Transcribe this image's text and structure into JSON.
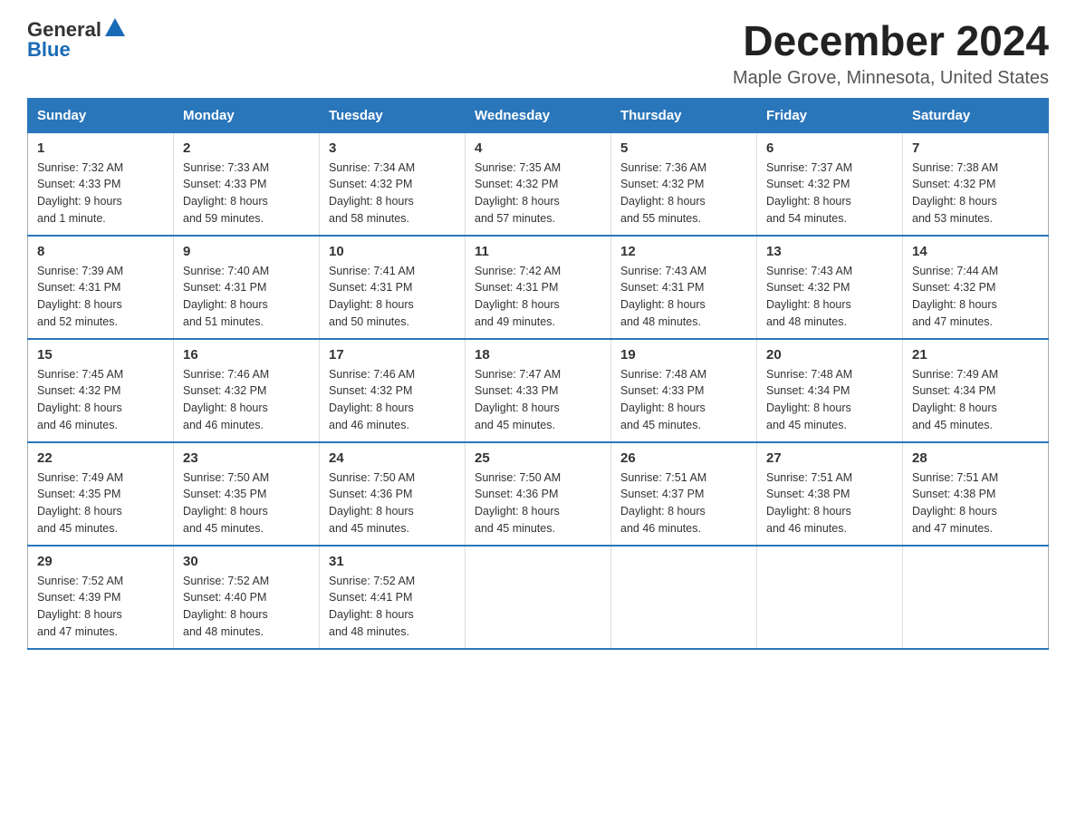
{
  "header": {
    "logo_general": "General",
    "logo_blue": "Blue",
    "month_title": "December 2024",
    "location": "Maple Grove, Minnesota, United States"
  },
  "days_of_week": [
    "Sunday",
    "Monday",
    "Tuesday",
    "Wednesday",
    "Thursday",
    "Friday",
    "Saturday"
  ],
  "weeks": [
    [
      {
        "day": "1",
        "sunrise": "7:32 AM",
        "sunset": "4:33 PM",
        "daylight": "9 hours and 1 minute."
      },
      {
        "day": "2",
        "sunrise": "7:33 AM",
        "sunset": "4:33 PM",
        "daylight": "8 hours and 59 minutes."
      },
      {
        "day": "3",
        "sunrise": "7:34 AM",
        "sunset": "4:32 PM",
        "daylight": "8 hours and 58 minutes."
      },
      {
        "day": "4",
        "sunrise": "7:35 AM",
        "sunset": "4:32 PM",
        "daylight": "8 hours and 57 minutes."
      },
      {
        "day": "5",
        "sunrise": "7:36 AM",
        "sunset": "4:32 PM",
        "daylight": "8 hours and 55 minutes."
      },
      {
        "day": "6",
        "sunrise": "7:37 AM",
        "sunset": "4:32 PM",
        "daylight": "8 hours and 54 minutes."
      },
      {
        "day": "7",
        "sunrise": "7:38 AM",
        "sunset": "4:32 PM",
        "daylight": "8 hours and 53 minutes."
      }
    ],
    [
      {
        "day": "8",
        "sunrise": "7:39 AM",
        "sunset": "4:31 PM",
        "daylight": "8 hours and 52 minutes."
      },
      {
        "day": "9",
        "sunrise": "7:40 AM",
        "sunset": "4:31 PM",
        "daylight": "8 hours and 51 minutes."
      },
      {
        "day": "10",
        "sunrise": "7:41 AM",
        "sunset": "4:31 PM",
        "daylight": "8 hours and 50 minutes."
      },
      {
        "day": "11",
        "sunrise": "7:42 AM",
        "sunset": "4:31 PM",
        "daylight": "8 hours and 49 minutes."
      },
      {
        "day": "12",
        "sunrise": "7:43 AM",
        "sunset": "4:31 PM",
        "daylight": "8 hours and 48 minutes."
      },
      {
        "day": "13",
        "sunrise": "7:43 AM",
        "sunset": "4:32 PM",
        "daylight": "8 hours and 48 minutes."
      },
      {
        "day": "14",
        "sunrise": "7:44 AM",
        "sunset": "4:32 PM",
        "daylight": "8 hours and 47 minutes."
      }
    ],
    [
      {
        "day": "15",
        "sunrise": "7:45 AM",
        "sunset": "4:32 PM",
        "daylight": "8 hours and 46 minutes."
      },
      {
        "day": "16",
        "sunrise": "7:46 AM",
        "sunset": "4:32 PM",
        "daylight": "8 hours and 46 minutes."
      },
      {
        "day": "17",
        "sunrise": "7:46 AM",
        "sunset": "4:32 PM",
        "daylight": "8 hours and 46 minutes."
      },
      {
        "day": "18",
        "sunrise": "7:47 AM",
        "sunset": "4:33 PM",
        "daylight": "8 hours and 45 minutes."
      },
      {
        "day": "19",
        "sunrise": "7:48 AM",
        "sunset": "4:33 PM",
        "daylight": "8 hours and 45 minutes."
      },
      {
        "day": "20",
        "sunrise": "7:48 AM",
        "sunset": "4:34 PM",
        "daylight": "8 hours and 45 minutes."
      },
      {
        "day": "21",
        "sunrise": "7:49 AM",
        "sunset": "4:34 PM",
        "daylight": "8 hours and 45 minutes."
      }
    ],
    [
      {
        "day": "22",
        "sunrise": "7:49 AM",
        "sunset": "4:35 PM",
        "daylight": "8 hours and 45 minutes."
      },
      {
        "day": "23",
        "sunrise": "7:50 AM",
        "sunset": "4:35 PM",
        "daylight": "8 hours and 45 minutes."
      },
      {
        "day": "24",
        "sunrise": "7:50 AM",
        "sunset": "4:36 PM",
        "daylight": "8 hours and 45 minutes."
      },
      {
        "day": "25",
        "sunrise": "7:50 AM",
        "sunset": "4:36 PM",
        "daylight": "8 hours and 45 minutes."
      },
      {
        "day": "26",
        "sunrise": "7:51 AM",
        "sunset": "4:37 PM",
        "daylight": "8 hours and 46 minutes."
      },
      {
        "day": "27",
        "sunrise": "7:51 AM",
        "sunset": "4:38 PM",
        "daylight": "8 hours and 46 minutes."
      },
      {
        "day": "28",
        "sunrise": "7:51 AM",
        "sunset": "4:38 PM",
        "daylight": "8 hours and 47 minutes."
      }
    ],
    [
      {
        "day": "29",
        "sunrise": "7:52 AM",
        "sunset": "4:39 PM",
        "daylight": "8 hours and 47 minutes."
      },
      {
        "day": "30",
        "sunrise": "7:52 AM",
        "sunset": "4:40 PM",
        "daylight": "8 hours and 48 minutes."
      },
      {
        "day": "31",
        "sunrise": "7:52 AM",
        "sunset": "4:41 PM",
        "daylight": "8 hours and 48 minutes."
      },
      null,
      null,
      null,
      null
    ]
  ],
  "labels": {
    "sunrise": "Sunrise:",
    "sunset": "Sunset:",
    "daylight": "Daylight:"
  }
}
